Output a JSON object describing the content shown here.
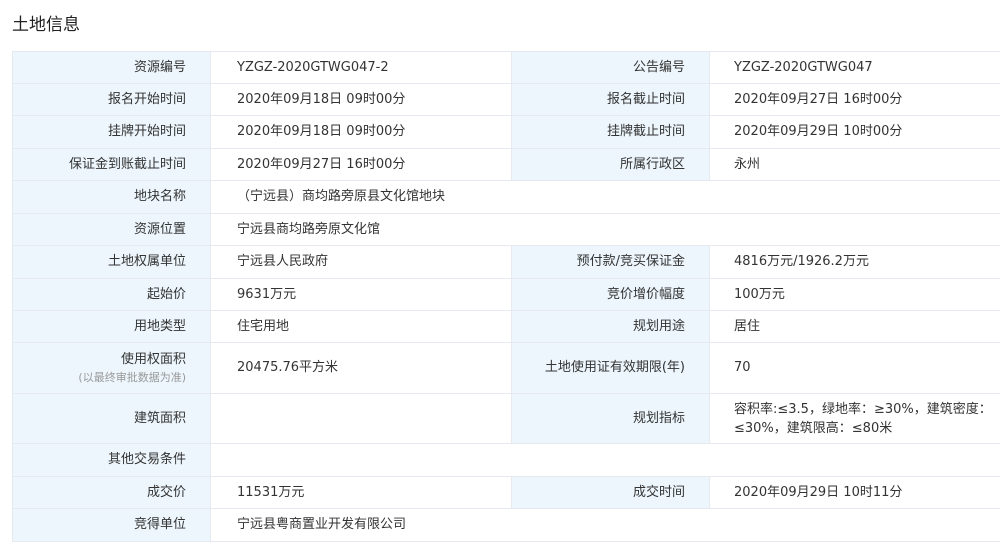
{
  "page": {
    "title": "土地信息"
  },
  "rows": {
    "r1": {
      "k1": "资源编号",
      "v1": "YZGZ-2020GTWG047-2",
      "k2": "公告编号",
      "v2": "YZGZ-2020GTWG047"
    },
    "r2": {
      "k1": "报名开始时间",
      "v1": "2020年09月18日 09时00分",
      "k2": "报名截止时间",
      "v2": "2020年09月27日 16时00分"
    },
    "r3": {
      "k1": "挂牌开始时间",
      "v1": "2020年09月18日 09时00分",
      "k2": "挂牌截止时间",
      "v2": "2020年09月29日 10时00分"
    },
    "r4": {
      "k1": "保证金到账截止时间",
      "v1": "2020年09月27日 16时00分",
      "k2": "所属行政区",
      "v2": "永州"
    },
    "r5": {
      "k1": "地块名称",
      "v1": "（宁远县）商均路旁原县文化馆地块"
    },
    "r6": {
      "k1": "资源位置",
      "v1": "宁远县商均路旁原文化馆"
    },
    "r7": {
      "k1": "土地权属单位",
      "v1": "宁远县人民政府",
      "k2": "预付款/竞买保证金",
      "v2": "4816万元/1926.2万元"
    },
    "r8": {
      "k1": "起始价",
      "v1": "9631万元",
      "k2": "竞价增价幅度",
      "v2": "100万元"
    },
    "r9": {
      "k1": "用地类型",
      "v1": "住宅用地",
      "k2": "规划用途",
      "v2": "居住"
    },
    "r10": {
      "k1": "使用权面积",
      "k1_note": "(以最终审批数据为准)",
      "v1": "20475.76平方米",
      "k2": "土地使用证有效期限(年)",
      "v2": "70"
    },
    "r11": {
      "k1": "建筑面积",
      "v1": "",
      "k2": "规划指标",
      "v2_line1": "容积率:≤3.5，绿地率：≥30%，建筑密度：",
      "v2_line2": "≤30%，建筑限高：≤80米"
    },
    "r12": {
      "k1": "其他交易条件",
      "v1": ""
    },
    "r13": {
      "k1": "成交价",
      "v1": "11531万元",
      "k2": "成交时间",
      "v2": "2020年09月29日 10时11分"
    },
    "r14": {
      "k1": "竞得单位",
      "v1": "宁远县粤商置业开发有限公司"
    }
  }
}
